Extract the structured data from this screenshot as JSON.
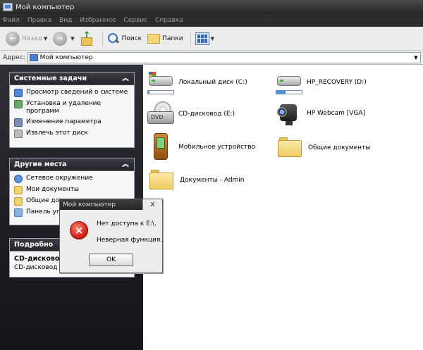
{
  "window": {
    "title": "Мой компьютер"
  },
  "menu": [
    "Файл",
    "Правка",
    "Вид",
    "Избранное",
    "Сервис",
    "Справка"
  ],
  "toolbar": {
    "back_label": "Назад",
    "search_label": "Поиск",
    "folders_label": "Папки"
  },
  "address": {
    "label": "Адрес:",
    "value": "Мой компьютер"
  },
  "left": {
    "system_tasks": {
      "title": "Системные задачи",
      "items": [
        "Просмотр сведений о системе",
        "Установка и удаление программ",
        "Изменение параметра",
        "Извлечь этот диск"
      ]
    },
    "other_places": {
      "title": "Другие места",
      "items": [
        "Сетевое окружение",
        "Мои документы",
        "Общие док",
        "Панель уп"
      ]
    },
    "details": {
      "title": "Подробно",
      "name": "CD-дисковод",
      "type": "CD-дисковод"
    }
  },
  "items": [
    {
      "label": "Локальный диск (C:)",
      "icon": "hard-drive-icon",
      "usage": 0.05
    },
    {
      "label": "HP_RECOVERY (D:)",
      "icon": "hard-drive-icon",
      "usage": 0.35
    },
    {
      "label": "CD-дисковод (E:)",
      "icon": "dvd-drive-icon",
      "drive_text": "DVD"
    },
    {
      "label": "HP Webcam [VGA]",
      "icon": "webcam-icon"
    },
    {
      "label": "Мобильное устройство",
      "icon": "mobile-device-icon"
    },
    {
      "label": "Общие документы",
      "icon": "folder-icon"
    },
    {
      "label": "Документы - Admin",
      "icon": "folder-icon"
    }
  ],
  "dialog": {
    "title": "Мой компьютер",
    "close": "x",
    "message1": "Нет доступа к E:\\.",
    "message2": "Неверная функция.",
    "ok": "OK"
  },
  "colors": {
    "title_bar": "#262626",
    "left_pane": "#1d1e22",
    "error_red": "#c81d12"
  }
}
